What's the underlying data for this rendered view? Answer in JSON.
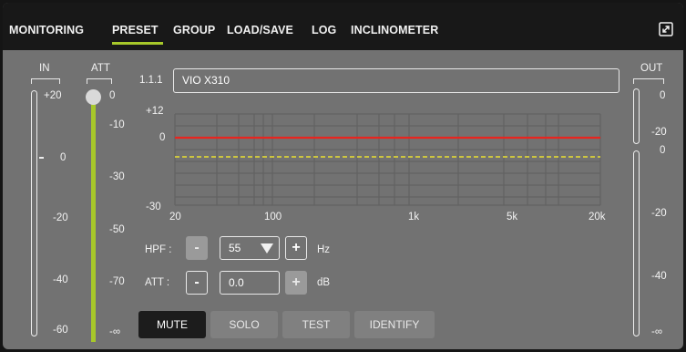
{
  "nav": {
    "tabs": [
      {
        "label": "MONITORING"
      },
      {
        "label": "PRESET"
      },
      {
        "label": "GROUP"
      },
      {
        "label": "LOAD/SAVE"
      },
      {
        "label": "LOG"
      },
      {
        "label": "INCLINOMETER"
      }
    ],
    "active_tab": "PRESET",
    "expand_icon": "expand-arrows-icon"
  },
  "in_meter": {
    "label": "IN",
    "scale": [
      "+20",
      "0",
      "-20",
      "-40",
      "-60"
    ]
  },
  "att_slider": {
    "label": "ATT",
    "scale": [
      "0",
      "-10",
      "-30",
      "-50",
      "-70",
      "-∞"
    ],
    "value_db": 0
  },
  "out_meter": {
    "label": "OUT",
    "scale_top": [
      "0",
      "-20"
    ],
    "scale_bottom": [
      "0",
      "-20",
      "-40",
      "-∞"
    ]
  },
  "channel": {
    "id": "1.1.1",
    "name": "VIO X310"
  },
  "eq_graph": {
    "y_labels": [
      "+12",
      "0",
      "-30"
    ],
    "x_labels": [
      "20",
      "100",
      "1k",
      "5k",
      "20k"
    ],
    "curves": [
      {
        "color": "#e8251f",
        "style": "solid"
      },
      {
        "color": "#d9d13a",
        "style": "dashed"
      }
    ]
  },
  "hpf": {
    "label": "HPF :",
    "minus": "-",
    "value": "55",
    "plus": "+",
    "unit": "Hz"
  },
  "att": {
    "label": "ATT :",
    "minus": "-",
    "value": "0.0",
    "plus": "+",
    "unit": "dB"
  },
  "buttons": [
    {
      "label": "MUTE",
      "active": true
    },
    {
      "label": "SOLO",
      "active": false
    },
    {
      "label": "TEST",
      "active": false
    },
    {
      "label": "IDENTIFY",
      "active": false
    }
  ],
  "colors": {
    "accent": "#a7c82a",
    "panel": "#727272",
    "nav": "#181818",
    "curve_red": "#e8251f",
    "curve_yellow": "#d9d13a"
  }
}
